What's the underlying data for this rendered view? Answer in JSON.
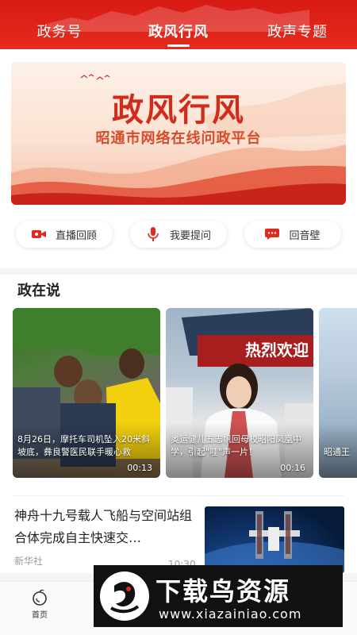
{
  "tabs": [
    {
      "label": "政务号",
      "active": false
    },
    {
      "label": "政风行风",
      "active": true
    },
    {
      "label": "政声专题",
      "active": false
    }
  ],
  "banner": {
    "title": "政风行风",
    "subtitle": "昭通市网络在线问政平台"
  },
  "actions": [
    {
      "label": "直播回顾",
      "icon": "video-camera-icon"
    },
    {
      "label": "我要提问",
      "icon": "microphone-icon"
    },
    {
      "label": "回音壁",
      "icon": "chat-bubble-icon"
    }
  ],
  "section": {
    "title": "政在说",
    "videos": [
      {
        "caption": "8月26日，摩托车司机坠入20米斜坡底，彝良警医民联手暖心救",
        "duration": "00:13"
      },
      {
        "caption": "奥运健儿五志帆回母校昭阳凤凰中学，引起\"哇\"声一片！",
        "duration": "00:16"
      },
      {
        "caption": "昭通王珂学校着成",
        "duration": ""
      }
    ]
  },
  "news": {
    "headline": "神舟十九号载人飞船与空间站组合体完成自主快速交…",
    "source": "新华社",
    "time": "10:30"
  },
  "bottom_nav": {
    "home_label": "首页"
  },
  "watermark": {
    "brand": "下载鸟资源",
    "url": "www.xiazainiao.com"
  },
  "colors": {
    "brand_red": "#e02a1f",
    "banner_text": "#d42a1a"
  }
}
